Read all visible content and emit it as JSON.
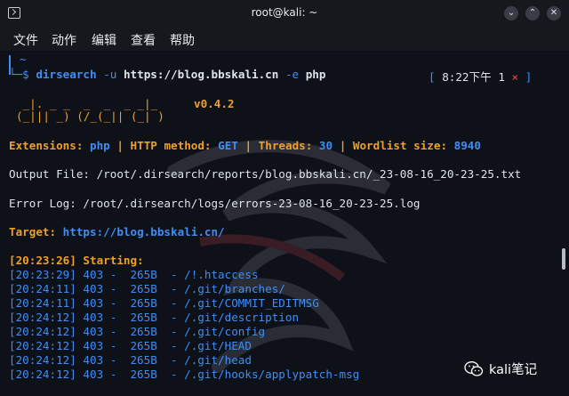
{
  "window": {
    "title": "root@kali: ~",
    "btn_min": "⌄",
    "btn_max": "⌃",
    "btn_close": "✕"
  },
  "menu": {
    "items": [
      "文件",
      "动作",
      "编辑",
      "查看",
      "帮助"
    ]
  },
  "prompt": {
    "tilde": "~",
    "command": "dirsearch",
    "flag_u": "-u",
    "url": "https://blog.bbskali.cn",
    "flag_e": "-e",
    "ext": "php",
    "status_open": "[",
    "time": "8:22下午",
    "count": "1",
    "status_x": "×",
    "status_close": "]"
  },
  "banner": {
    "line1": " _|. _ _  _  _  _ _|_",
    "line2": "(_||| _) (/_(_|| (_| )",
    "version": "v0.4.2"
  },
  "info": {
    "ext_label": "Extensions:",
    "ext_value": "php",
    "method_label": "HTTP method:",
    "method_value": "GET",
    "threads_label": "Threads:",
    "threads_value": "30",
    "wordlist_label": "Wordlist size:",
    "wordlist_value": "8940",
    "sep": "|"
  },
  "output_file": "Output File: /root/.dirsearch/reports/blog.bbskali.cn/_23-08-16_20-23-25.txt",
  "error_log": "Error Log: /root/.dirsearch/logs/errors-23-08-16_20-23-25.log",
  "target": {
    "label": "Target:",
    "url": "https://blog.bbskali.cn/"
  },
  "starting": "[20:23:26] Starting:",
  "results": [
    "[20:23:29] 403 -  265B  - /!.htaccess",
    "[20:24:11] 403 -  265B  - /.git/branches/",
    "[20:24:11] 403 -  265B  - /.git/COMMIT_EDITMSG",
    "[20:24:12] 403 -  265B  - /.git/description",
    "[20:24:12] 403 -  265B  - /.git/config",
    "[20:24:12] 403 -  265B  - /.git/HEAD",
    "[20:24:12] 403 -  265B  - /.git/head",
    "[20:24:12] 403 -  265B  - /.git/hooks/applypatch-msg"
  ],
  "watermark_label": "kali笔记",
  "colors": {
    "accent_blue": "#3f8ef7",
    "accent_orange": "#f0a02a",
    "error_red": "#f24848",
    "background": "#0e1118"
  }
}
